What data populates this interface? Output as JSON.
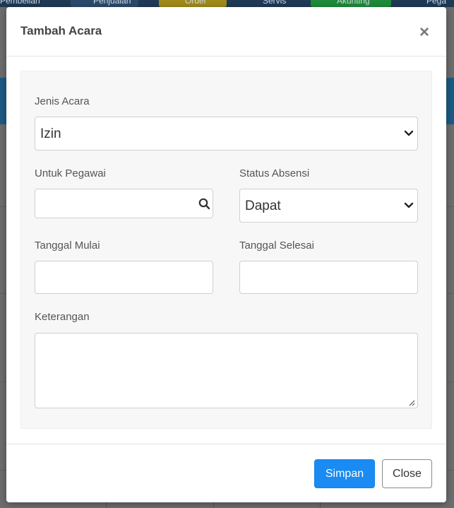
{
  "background": {
    "nav": {
      "pembelian": "Pembelian",
      "penjualan": "Penjualan",
      "order": "Order",
      "servis": "Servis",
      "akunting": "Akunting",
      "pegawai": "Pega"
    }
  },
  "modal": {
    "title": "Tambah Acara",
    "close_symbol": "×",
    "fields": {
      "jenis_acara": {
        "label": "Jenis Acara",
        "value": "Izin"
      },
      "untuk_pegawai": {
        "label": "Untuk Pegawai",
        "value": ""
      },
      "status_absensi": {
        "label": "Status Absensi",
        "value": "Dapat"
      },
      "tanggal_mulai": {
        "label": "Tanggal Mulai",
        "value": ""
      },
      "tanggal_selesai": {
        "label": "Tanggal Selesai",
        "value": ""
      },
      "keterangan": {
        "label": "Keterangan",
        "value": ""
      }
    },
    "buttons": {
      "save": "Simpan",
      "close": "Close"
    }
  },
  "colors": {
    "primary": "#1a8bf2",
    "nav_bg": "#1f3a56",
    "overlay": "#6d6d6d"
  }
}
